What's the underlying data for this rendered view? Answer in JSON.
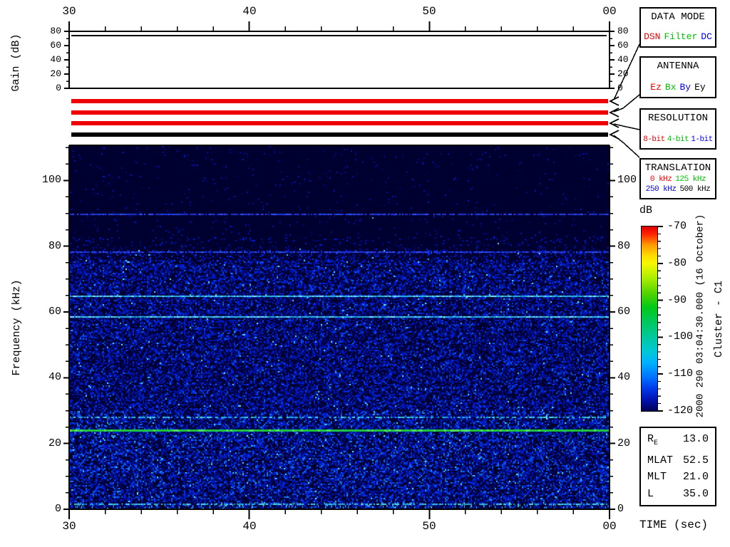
{
  "gain_panel": {
    "ylabel": "Gain (dB)",
    "ytick_labels": [
      "80",
      "60",
      "40",
      "20",
      "0"
    ],
    "ytick_values": [
      80,
      60,
      40,
      20,
      0
    ],
    "trace_db": 74
  },
  "time_axis": {
    "xlabel": "TIME (sec)",
    "tick_labels": [
      "30",
      "40",
      "50",
      "00"
    ],
    "tick_values_sec": [
      30,
      40,
      50,
      60
    ],
    "minor_step_sec": 2
  },
  "freq_axis": {
    "ylabel": "Frequency (kHz)",
    "tick_labels": [
      "100",
      "80",
      "60",
      "40",
      "20",
      "0"
    ],
    "tick_values_khz": [
      100,
      80,
      60,
      40,
      20,
      0
    ],
    "minor_step_khz": 5,
    "max_khz": 110.7
  },
  "colorbar": {
    "label": "dB",
    "tick_labels": [
      "-70",
      "-80",
      "-90",
      "-100",
      "-110",
      "-120"
    ],
    "tick_values": [
      -70,
      -80,
      -90,
      -100,
      -110,
      -120
    ],
    "minor_step": 2,
    "gradient": [
      {
        "pos": 0.0,
        "color": "#dd0000"
      },
      {
        "pos": 0.04,
        "color": "#ff2200"
      },
      {
        "pos": 0.1,
        "color": "#ff9900"
      },
      {
        "pos": 0.16,
        "color": "#ffdd00"
      },
      {
        "pos": 0.2,
        "color": "#f8f800"
      },
      {
        "pos": 0.28,
        "color": "#aaee00"
      },
      {
        "pos": 0.36,
        "color": "#55d400"
      },
      {
        "pos": 0.44,
        "color": "#00c818"
      },
      {
        "pos": 0.52,
        "color": "#00c860"
      },
      {
        "pos": 0.6,
        "color": "#00c89e"
      },
      {
        "pos": 0.68,
        "color": "#00c8d8"
      },
      {
        "pos": 0.74,
        "color": "#00b0ff"
      },
      {
        "pos": 0.82,
        "color": "#0070ff"
      },
      {
        "pos": 0.88,
        "color": "#0038e8"
      },
      {
        "pos": 0.94,
        "color": "#0012b0"
      },
      {
        "pos": 1.0,
        "color": "#000058"
      }
    ]
  },
  "annotations": {
    "datetime_vertical": "2000 290 03:04:30.000 (16 October)",
    "spacecraft_vertical": "Cluster - C1"
  },
  "legend_boxes": [
    {
      "title": "DATA MODE",
      "options": [
        {
          "label": "DSN",
          "color": "#ee0000"
        },
        {
          "label": "Filter",
          "color": "#00c000"
        },
        {
          "label": "DC",
          "color": "#0000ee"
        }
      ]
    },
    {
      "title": "ANTENNA",
      "options": [
        {
          "label": "Ez",
          "color": "#ee0000"
        },
        {
          "label": "Bx",
          "color": "#00c000"
        },
        {
          "label": "By",
          "color": "#0000ee"
        },
        {
          "label": "Ey",
          "color": "#000000"
        }
      ]
    },
    {
      "title": "RESOLUTION",
      "options": [
        {
          "label": "8-bit",
          "color": "#ee0000"
        },
        {
          "label": "4-bit",
          "color": "#00c000"
        },
        {
          "label": "1-bit",
          "color": "#0000ee"
        }
      ]
    },
    {
      "title": "TRANSLATION",
      "options": [
        {
          "label": "0 kHz",
          "color": "#ee0000"
        },
        {
          "label": "125 kHz",
          "color": "#00c000"
        },
        {
          "label": "250 kHz",
          "color": "#0000ee"
        },
        {
          "label": "500 kHz",
          "color": "#000000"
        }
      ]
    }
  ],
  "status_bars": [
    {
      "name": "data-mode-bar",
      "selected": "DSN",
      "color": "#ee0000"
    },
    {
      "name": "antenna-bar",
      "selected": "Ez",
      "color": "#ee0000"
    },
    {
      "name": "resolution-bar",
      "selected": "8-bit",
      "color": "#ee0000"
    },
    {
      "name": "translation-bar",
      "selected": "500 kHz",
      "color": "#000000"
    }
  ],
  "info_box": {
    "rows": [
      {
        "label": "R",
        "sub": "E",
        "value": "13.0"
      },
      {
        "label": "MLAT",
        "sub": "",
        "value": "52.5"
      },
      {
        "label": "MLT",
        "sub": "",
        "value": "21.0"
      },
      {
        "label": "L",
        "sub": "",
        "value": "35.0"
      }
    ]
  },
  "chart_data": {
    "type": "heatmap",
    "title": "Cluster - C1 WBD wideband spectrogram, 2000 290 03:04:30.000 (16 October)",
    "xlabel": "TIME (sec)",
    "ylabel": "Frequency (kHz)",
    "x_range_sec": [
      30,
      60
    ],
    "x_major_ticks_sec": [
      30,
      40,
      50,
      60
    ],
    "x_tick_labels": [
      "30",
      "40",
      "50",
      "00"
    ],
    "x_minor_step_sec": 2,
    "y_range_khz": [
      0,
      110.7
    ],
    "y_major_ticks_khz": [
      0,
      20,
      40,
      60,
      80,
      100
    ],
    "y_minor_step_khz": 5,
    "color_scale": {
      "label": "dB",
      "max_db": -70,
      "min_db": -120,
      "major_ticks_db": [
        -70,
        -80,
        -90,
        -100,
        -110,
        -120
      ],
      "minor_step_db": 2
    },
    "gain_subpanel": {
      "ylabel": "Gain (dB)",
      "range_db": [
        0,
        80
      ],
      "major_ticks_db": [
        0,
        20,
        40,
        60,
        80
      ],
      "minor_step_db": 10,
      "trace_constant_db": 74
    },
    "background_level_db": -120,
    "broadband_noise": {
      "freq_range_khz": [
        0,
        80
      ],
      "level_range_db": [
        -119,
        -104
      ]
    },
    "spectral_lines": [
      {
        "freq_khz": 90,
        "level_db": -112,
        "style": "faint-blue"
      },
      {
        "freq_khz": 78.5,
        "level_db": -111,
        "style": "faint-blue"
      },
      {
        "freq_khz": 65,
        "level_db": -103,
        "style": "cyan"
      },
      {
        "freq_khz": 58.7,
        "level_db": -105,
        "style": "cyan"
      },
      {
        "freq_khz": 28,
        "level_db": -106,
        "style": "cyan-speckle"
      },
      {
        "freq_khz": 24,
        "level_db": -93,
        "style": "bright-green"
      },
      {
        "freq_khz": 1.5,
        "level_db": -107,
        "style": "cyan-speckle"
      }
    ]
  }
}
